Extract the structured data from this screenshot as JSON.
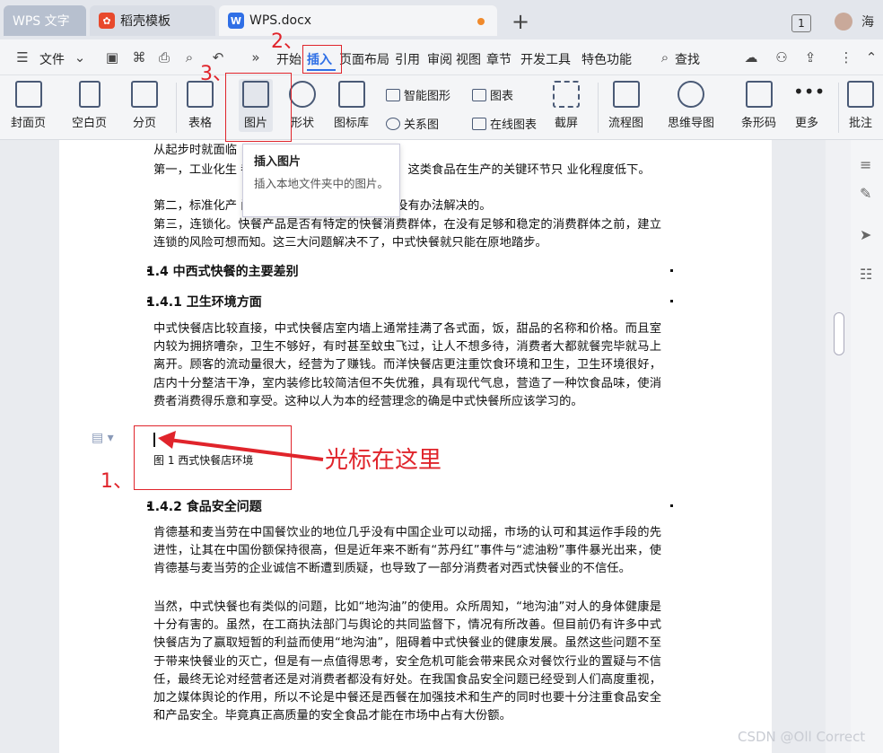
{
  "titlebar": {
    "tabs": [
      {
        "label": "WPS 文字"
      },
      {
        "label": "稻壳模板"
      },
      {
        "label": "WPS.docx"
      }
    ],
    "badge": "1",
    "user_name": "海"
  },
  "menubar": {
    "file_label": "文件",
    "items": [
      "开始",
      "插入",
      "页面布局",
      "引用",
      "审阅",
      "视图",
      "章节",
      "开发工具",
      "特色功能"
    ],
    "search_label": "查找"
  },
  "ribbon": {
    "cover": "封面页",
    "blank": "空白页",
    "pagebreak": "分页",
    "table": "表格",
    "picture": "图片",
    "shape": "形状",
    "iconlib": "图标库",
    "smartart": "智能图形",
    "chart": "图表",
    "relation": "关系图",
    "onlinechart": "在线图表",
    "screenshot": "截屏",
    "flowchart": "流程图",
    "mindmap": "思维导图",
    "barcode": "条形码",
    "more": "更多",
    "comment": "批注"
  },
  "tooltip": {
    "title": "插入图片",
    "desc": "插入本地文件夹中的图片。"
  },
  "document": {
    "p0": "从起步时就面临",
    "p1": "第一，工业化生                    都是从传统食品中筛选出来的，这类食品在生产的关键环节只                    业化程度低下。",
    "p2": "第二，标准化产                    问题解决不了，标准化问题是没有办法解决的。",
    "p3": "第三，连锁化。快餐产品是否有特定的快餐消费群体，在没有足够和稳定的消费群体之前，建立连锁的风险可想而知。这三大问题解决不了，中式快餐就只能在原地踏步。",
    "h14": "1.4  中西式快餐的主要差别",
    "h141": "1.4.1  卫生环境方面",
    "p4": "中式快餐店比较直接，中式快餐店室内墙上通常挂满了各式面，饭，甜品的名称和价格。而且室内较为拥挤嘈杂，卫生不够好，有时甚至蚊虫飞过，让人不想多待，消费者大都就餐完毕就马上离开。顾客的流动量很大，经营为了赚钱。而洋快餐店更注重饮食环境和卫生，卫生环境很好，店内十分整洁干净，室内装修比较简洁但不失优雅，具有现代气息，营造了一种饮食品味，使消费者消费得乐意和享受。这种以人为本的经营理念的确是中式快餐所应该学习的。",
    "caption": "图 1  西式快餐店环境",
    "h142": "1.4.2  食品安全问题",
    "p5": "肯德基和麦当劳在中国餐饮业的地位几乎没有中国企业可以动摇，市场的认可和其运作手段的先进性，让其在中国份额保持很高，但是近年来不断有“苏丹红”事件与“滤油粉”事件暴光出来，使肯德基与麦当劳的企业诚信不断遭到质疑，也导致了一部分消费者对西式快餐业的不信任。",
    "p6": "当然，中式快餐也有类似的问题，比如“地沟油”的使用。众所周知，“地沟油”对人的身体健康是十分有害的。虽然，在工商执法部门与舆论的共同监督下，情况有所改善。但目前仍有许多中式快餐店为了赢取短暂的利益而使用“地沟油”，阻碍着中式快餐业的健康发展。虽然这些问题不至于带来快餐业的灭亡，但是有一点值得思考，安全危机可能会带来民众对餐饮行业的置疑与不信任，最终无论对经营者还是对消费者都没有好处。在我国食品安全问题已经受到人们高度重视，加之媒体舆论的作用，所以不论是中餐还是西餐在加强技术和生产的同时也要十分注重食品安全和产品安全。毕竟真正高质量的安全食品才能在市场中占有大份额。"
  },
  "annotations": {
    "n1": "1、",
    "n2": "2、",
    "n3": "3、",
    "arrow_text": "光标在这里"
  },
  "watermark": "CSDN @Oll Correct",
  "colors": {
    "accent": "#2f6fe6",
    "annotation": "#e0242b"
  }
}
